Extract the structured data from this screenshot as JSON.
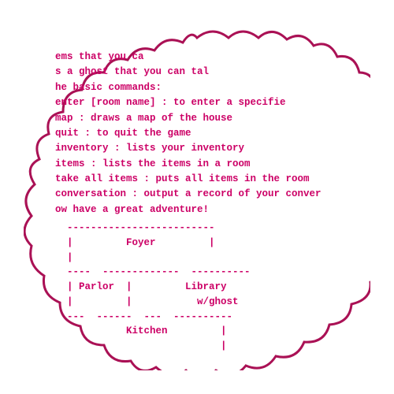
{
  "terminal": {
    "lines": [
      "ems that you ca",
      "s a ghost that you can tal",
      "he basic commands:",
      "enter [room name] : to enter a specifie",
      "map : draws a map of the house",
      "quit : to quit the game",
      "inventory : lists your inventory",
      "items : lists the items in a room",
      "take all items : puts all items in the room",
      "conversation : output a record of your conver",
      "ow have a great adventure!"
    ],
    "map": "  -------------------------\n  |         Foyer         |\n  |\n  ----  -------------  ----------\n  | Parlor  |         Library\n  |         |           w/ghost\n  ---  ------  ---  ----------\n            Kitchen         |\n                            |\n  -  --------------------------\n  try    |\n     ton |"
  },
  "border_color": "#aa1155",
  "text_color": "#cc0066"
}
